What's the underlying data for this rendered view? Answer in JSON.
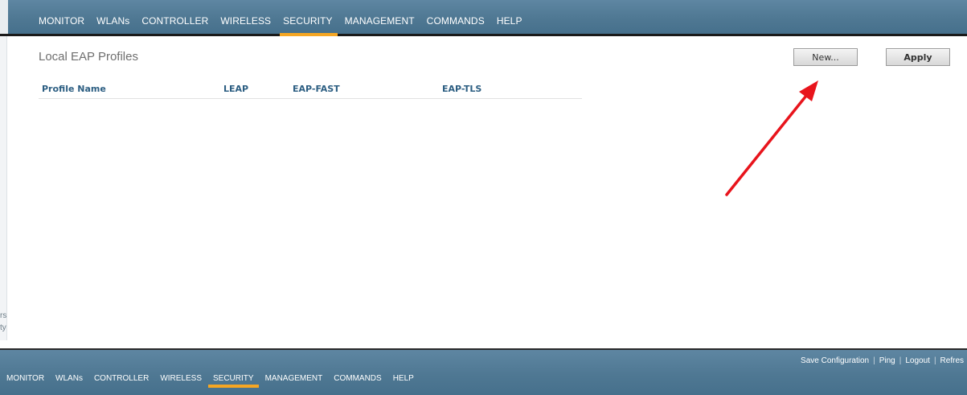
{
  "top_nav": {
    "items": [
      "MONITOR",
      "WLANs",
      "CONTROLLER",
      "WIRELESS",
      "SECURITY",
      "MANAGEMENT",
      "COMMANDS",
      "HELP"
    ],
    "active": "SECURITY"
  },
  "sidebar": {
    "fragments": [
      "rs",
      "ty"
    ]
  },
  "main": {
    "title": "Local EAP Profiles",
    "new_button": "New...",
    "apply_button": "Apply",
    "table": {
      "headers": [
        "Profile Name",
        "LEAP",
        "EAP-FAST",
        "EAP-TLS"
      ],
      "rows": []
    }
  },
  "bottom_bar": {
    "links": [
      "Save Configuration",
      "Ping",
      "Logout",
      "Refres"
    ],
    "nav": [
      "MONITOR",
      "WLANs",
      "CONTROLLER",
      "WIRELESS",
      "SECURITY",
      "MANAGEMENT",
      "COMMANDS",
      "HELP"
    ],
    "active": "SECURITY"
  },
  "colors": {
    "nav_bar": "#4f7893",
    "active_tab_underline": "#f5a623",
    "table_header": "#2c5e82",
    "annotation_arrow": "#e8141c"
  }
}
